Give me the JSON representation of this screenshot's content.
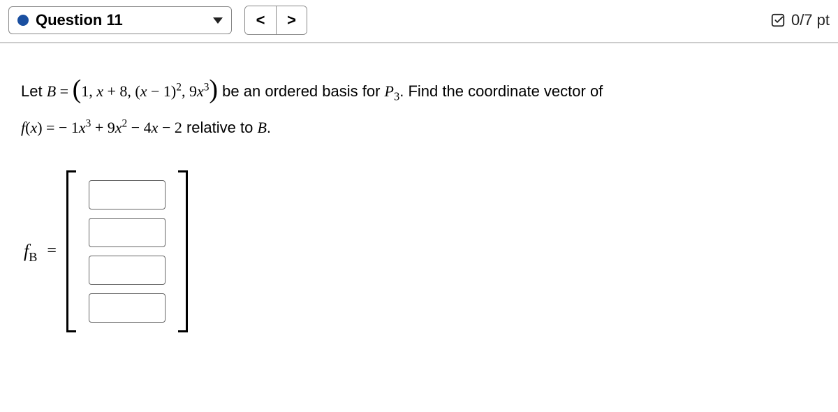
{
  "header": {
    "question_label": "Question 11",
    "prev_glyph": "<",
    "next_glyph": ">",
    "score_text": "0/7 pt"
  },
  "problem": {
    "let_text": "Let ",
    "B_label": "B",
    "eq_sym": " = ",
    "basis_open": "(",
    "basis_b1": "1, ",
    "basis_b2_a": "x",
    "basis_b2_b": " + 8, (",
    "basis_b3_a": "x",
    "basis_b3_b": " − 1)",
    "basis_b3_sup": "2",
    "basis_sep": ", 9",
    "basis_b4_a": "x",
    "basis_b4_sup": "3",
    "basis_close": ")",
    "mid_text_1": " be an ordered basis for ",
    "P_label": "P",
    "P_sub": "3",
    "mid_text_2": ". Find the coordinate vector of",
    "f_label": "f",
    "f_arg_open": "(",
    "f_arg": "x",
    "f_arg_close": ")",
    "poly_1": " − 1",
    "poly_x3": "x",
    "poly_sup3": "3",
    "poly_2": " + 9",
    "poly_x2": "x",
    "poly_sup2": "2",
    "poly_3": " − 4",
    "poly_x1": "x",
    "poly_4": " − 2",
    "rel_text": " relative to ",
    "B_label2": "B",
    "period": "."
  },
  "answer": {
    "label_f": "f",
    "label_sub": "B",
    "eq": "=",
    "cells": [
      "",
      "",
      "",
      ""
    ]
  }
}
